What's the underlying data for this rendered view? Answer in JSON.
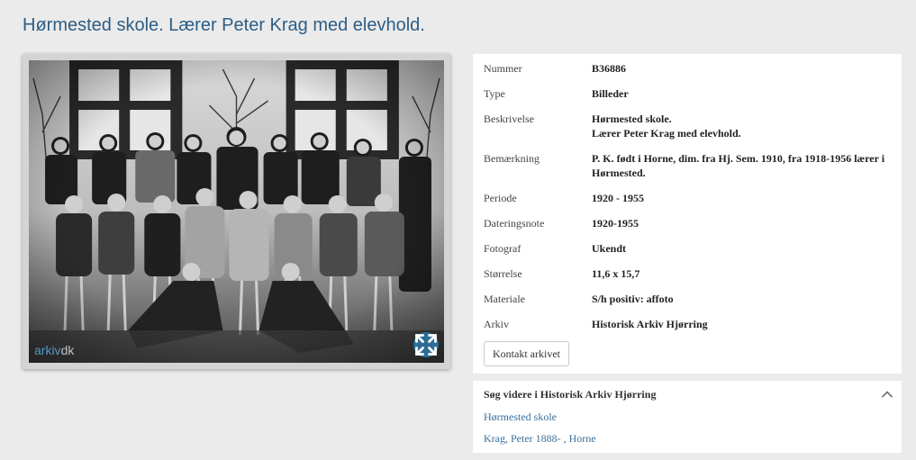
{
  "page": {
    "title": "Hørmested skole. Lærer Peter Krag med elevhold."
  },
  "photo": {
    "watermark_left": "arkiv",
    "watermark_right": "dk",
    "expand_icon": "expand-icon"
  },
  "metadata": {
    "rows": [
      {
        "key": "Nummer",
        "value": "B36886"
      },
      {
        "key": "Type",
        "value": "Billeder"
      },
      {
        "key": "Beskrivelse",
        "value": "Hørmested skole.\nLærer Peter Krag med elevhold."
      },
      {
        "key": "Bemærkning",
        "value": "P. K. født i Horne, dim. fra Hj. Sem. 1910, fra 1918-1956 lærer i Hørmested."
      },
      {
        "key": "Periode",
        "value": "1920 - 1955"
      },
      {
        "key": "Dateringsnote",
        "value": "1920-1955"
      },
      {
        "key": "Fotograf",
        "value": "Ukendt"
      },
      {
        "key": "Størrelse",
        "value": "11,6 x 15,7"
      },
      {
        "key": "Materiale",
        "value": "S/h positiv: affoto"
      },
      {
        "key": "Arkiv",
        "value": "Historisk Arkiv Hjørring"
      }
    ],
    "contact_button": "Kontakt arkivet"
  },
  "search": {
    "title": "Søg videre i Historisk Arkiv Hjørring",
    "links": [
      "Hørmested skole",
      "Krag, Peter 1888- , Horne"
    ]
  },
  "colors": {
    "title": "#2c5d85",
    "link": "#3a6f9c",
    "expand_button": "#2c6d96",
    "background": "#ebebeb"
  }
}
